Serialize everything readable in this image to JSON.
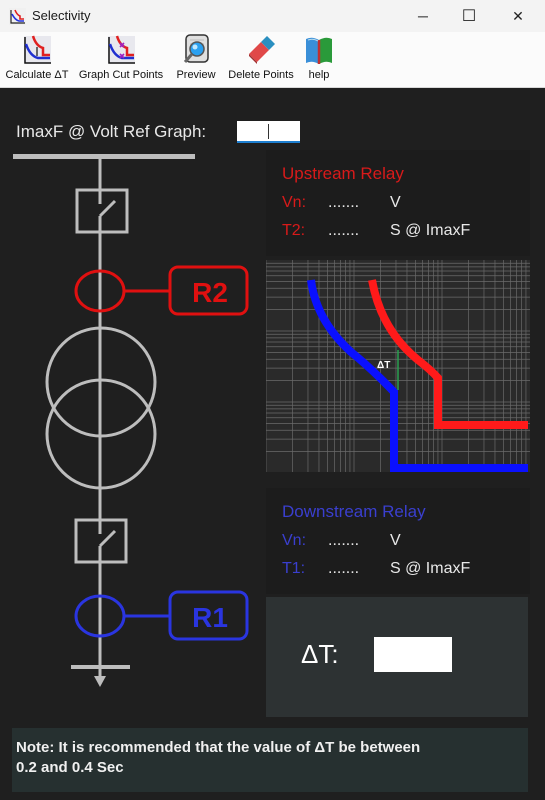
{
  "window": {
    "title": "Selectivity",
    "app_icon": "selectivity-chart-icon",
    "controls": {
      "minimize": "─",
      "maximize": "☐",
      "close": "✕"
    }
  },
  "toolbar": {
    "items": [
      {
        "label": "Calculate ΔT",
        "icon": "calculate-delta-t-icon"
      },
      {
        "label": "Graph Cut Points",
        "icon": "graph-cut-points-icon"
      },
      {
        "label": "Preview",
        "icon": "preview-magnifier-icon"
      },
      {
        "label": "Delete Points",
        "icon": "eraser-icon"
      },
      {
        "label": "help",
        "icon": "book-icon"
      }
    ]
  },
  "imaxf": {
    "label": "ImaxF @ Volt Ref Graph:",
    "value": ""
  },
  "diagram": {
    "relay_upstream_tag": "R2",
    "relay_downstream_tag": "R1",
    "colors": {
      "upstream": "#e01010",
      "downstream": "#2a35e0",
      "line": "#bdbdbd"
    }
  },
  "upstream": {
    "title": "Upstream Relay",
    "color": "#d81a1a",
    "vn_label": "Vn:",
    "vn_value": ".......",
    "vn_unit": "V",
    "t_label": "T2:",
    "t_value": ".......",
    "t_unit": "S @ ImaxF"
  },
  "graph": {
    "delta_label": "ΔT",
    "upstream_color": "#ff1a1a",
    "downstream_color": "#0a10ff",
    "delta_color": "#2aa050"
  },
  "downstream": {
    "title": "Downstream Relay",
    "color": "#3a3fcf",
    "vn_label": "Vn:",
    "vn_value": ".......",
    "vn_unit": "V",
    "t_label": "T1:",
    "t_value": ".......",
    "t_unit": "S @ ImaxF"
  },
  "result": {
    "label": "ΔT:",
    "value": ""
  },
  "note": {
    "line1": "Note: It is recommended that the value of ΔT be between",
    "line2": "0.2 and 0.4 Sec"
  }
}
